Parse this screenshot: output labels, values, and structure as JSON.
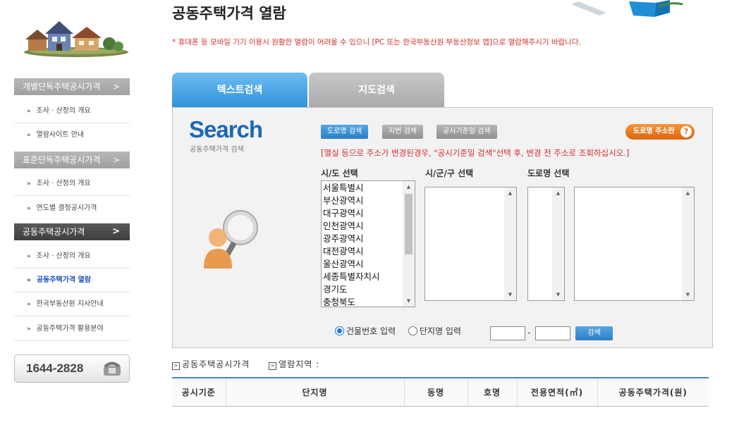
{
  "page": {
    "title": "공동주택가격 열람",
    "notice": "* 휴대폰 등 모바일 기기 이용시 원활한 열람이 어려울 수 있으니 [PC 또는 한국부동산원 부동산정보 앱]으로 열람해주시기 바랍니다."
  },
  "sidebar": {
    "sections": [
      {
        "label": "개별단독주택공시가격",
        "arrow": ">",
        "items": [
          "조사 · 산정의 개요",
          "열람사이트 안내"
        ]
      },
      {
        "label": "표준단독주택공시가격",
        "arrow": ">",
        "items": [
          "조사 · 산정의 개요",
          "연도별 결정공시가격"
        ]
      },
      {
        "label": "공동주택공시가격",
        "arrow": ">",
        "items": [
          "조사 · 산정의 개요",
          "공동주택가격 열람",
          "한국부동산원 지사안내",
          "공동주택가격 활용분야"
        ]
      }
    ],
    "bullet": "»",
    "phone": "1644-2828"
  },
  "tabs": [
    {
      "label": "텍스트검색",
      "active": true
    },
    {
      "label": "지도검색",
      "active": false
    }
  ],
  "search": {
    "logo_text": "Search",
    "logo_sub": "공동주택가격 검색",
    "buttons": {
      "road": "도로명 검색",
      "lot": "지번 검색",
      "date": "공시기준일 검색",
      "road_help": "도로명 주소란",
      "help_mark": "?"
    },
    "red_notice": "[멸실 등으로 주소가 변경된경우, \"공시기준일 검색\"선택 후, 변경 전 주소로 조회하십시오.]",
    "labels": {
      "sido": "시/도 선택",
      "sigungu": "시/군/구 선택",
      "road": "도로명 선택"
    },
    "sido_options": [
      "서울특별시",
      "부산광역시",
      "대구광역시",
      "인천광역시",
      "광주광역시",
      "대전광역시",
      "울산광역시",
      "세종특별자치시",
      "경기도",
      "충청북도"
    ],
    "radio": {
      "building": "건물번호 입력",
      "complex": "단지명 입력",
      "selected": "building"
    },
    "dash": "-",
    "submit": "검색"
  },
  "results": {
    "info_left": "공동주택공시가격",
    "info_right": "열람지역 :",
    "columns": [
      "공시기준",
      "단지명",
      "동명",
      "호명",
      "전용면적(㎡)",
      "공동주택가격(원)"
    ]
  },
  "colors": {
    "accent_blue": "#2f92d9",
    "notice_red": "#d82c2c",
    "orange": "#e06818"
  }
}
